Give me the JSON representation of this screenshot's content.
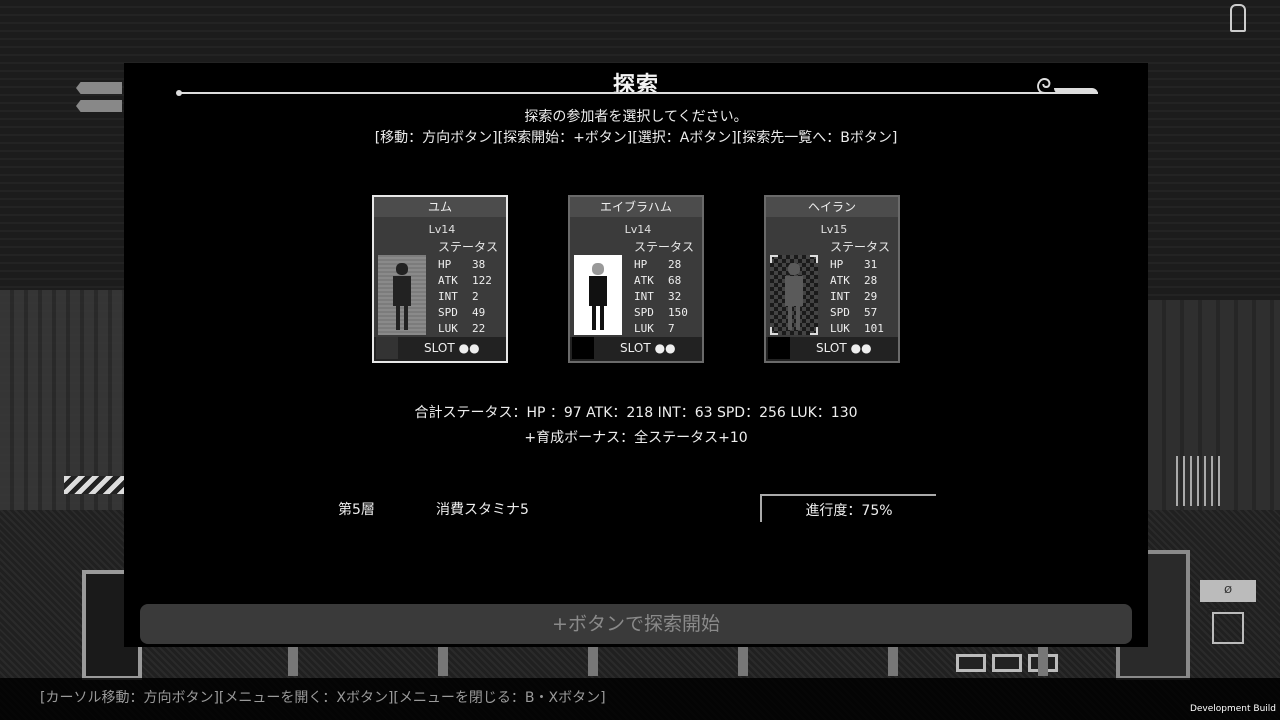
{
  "dialog": {
    "title": "探索",
    "instruction": "探索の参加者を選択してください。",
    "controls": "[移動：方向ボタン][探索開始：+ボタン][選択：Aボタン][探索先一覧へ：Bボタン]"
  },
  "characters": [
    {
      "name": "ユム",
      "level": "Lv14",
      "status_header": "ステータス",
      "stats": [
        [
          "HP",
          "38"
        ],
        [
          "ATK",
          "122"
        ],
        [
          "INT",
          "2"
        ],
        [
          "SPD",
          "49"
        ],
        [
          "LUK",
          "22"
        ]
      ],
      "slot_label": "SLOT",
      "slot_dots": "●●",
      "selected": true
    },
    {
      "name": "エイブラハム",
      "level": "Lv14",
      "status_header": "ステータス",
      "stats": [
        [
          "HP",
          "28"
        ],
        [
          "ATK",
          "68"
        ],
        [
          "INT",
          "32"
        ],
        [
          "SPD",
          "150"
        ],
        [
          "LUK",
          "7"
        ]
      ],
      "slot_label": "SLOT",
      "slot_dots": "●●",
      "selected": false
    },
    {
      "name": "ヘイラン",
      "level": "Lv15",
      "status_header": "ステータス",
      "stats": [
        [
          "HP",
          "31"
        ],
        [
          "ATK",
          "28"
        ],
        [
          "INT",
          "29"
        ],
        [
          "SPD",
          "57"
        ],
        [
          "LUK",
          "101"
        ]
      ],
      "slot_label": "SLOT",
      "slot_dots": "●●",
      "selected": false
    }
  ],
  "summary": {
    "total_status": "合計ステータス：HP ：97 ATK：218 INT：63 SPD：256 LUK：130",
    "bonus": "+育成ボーナス：全ステータス+10"
  },
  "expedition": {
    "floor": "第5層",
    "stamina_cost": "消費スタミナ5",
    "progress": "進行度：75%",
    "progress_value": 75
  },
  "start_button": "+ボタンで探索開始",
  "bottom_help": "[カーソル移動：方向ボタン][メニューを開く：Xボタン][メニューを閉じる：B・Xボタン]",
  "dev_build": "Development Build",
  "colors": {
    "panel": "#000000",
    "card": "#3b3b3b",
    "selected_border": "#e8e8e8",
    "button": "#3a3a3a"
  }
}
